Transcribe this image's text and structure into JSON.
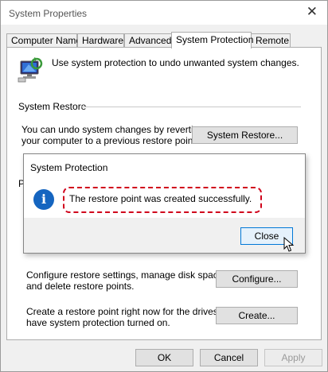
{
  "window": {
    "title": "System Properties",
    "close_glyph": "✕"
  },
  "tabs": [
    {
      "label": "Computer Name"
    },
    {
      "label": "Hardware"
    },
    {
      "label": "Advanced"
    },
    {
      "label": "System Protection"
    },
    {
      "label": "Remote"
    }
  ],
  "active_tab": "System Protection",
  "panel": {
    "intro_text": "Use system protection to undo unwanted system changes.",
    "restore_group_label": "System Restore",
    "restore_text_line1": "You can undo system changes by reverting",
    "restore_text_line2": "your computer to a previous restore point.",
    "restore_button": "System Restore...",
    "protection_group_partial": "P",
    "configure_text_line1": "Configure restore settings, manage disk space,",
    "configure_text_line2": "and delete restore points.",
    "configure_button": "Configure...",
    "create_text_line1": "Create a restore point right now for the drives that",
    "create_text_line2": "have system protection turned on.",
    "create_button": "Create..."
  },
  "footer": {
    "ok": "OK",
    "cancel": "Cancel",
    "apply": "Apply"
  },
  "dialog": {
    "title": "System Protection",
    "message": "The restore point was created successfully.",
    "close_button": "Close",
    "icon_glyph": "i"
  },
  "colors": {
    "accent": "#0078d7",
    "info_icon": "#1565c0",
    "highlight": "#d0021b"
  }
}
